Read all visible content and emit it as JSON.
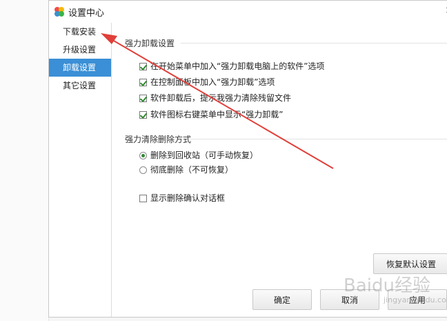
{
  "window": {
    "title": "设置中心",
    "close_glyph": "×"
  },
  "sidebar": {
    "items": [
      {
        "label": "下载安装",
        "active": false
      },
      {
        "label": "升级设置",
        "active": false
      },
      {
        "label": "卸载设置",
        "active": true
      },
      {
        "label": "其它设置",
        "active": false
      }
    ]
  },
  "uninstall_section": {
    "title": "强力卸载设置",
    "options": [
      {
        "label": "在开始菜单中加入“强力卸载电脑上的软件”选项",
        "checked": true
      },
      {
        "label": "在控制面板中加入“强力卸载”选项",
        "checked": true
      },
      {
        "label": "软件卸载后，提示我强力清除残留文件",
        "checked": true
      },
      {
        "label": "软件图标右键菜单中显示“强力卸载”",
        "checked": true
      }
    ]
  },
  "delete_section": {
    "title": "强力清除删除方式",
    "options": [
      {
        "label": "删除到回收站（可手动恢复）",
        "selected": true
      },
      {
        "label": "彻底删除（不可恢复）",
        "selected": false
      }
    ]
  },
  "confirm_dialog_option": {
    "label": "显示删除确认对话框",
    "checked": false
  },
  "buttons": {
    "restore_defaults": "恢复默认设置",
    "ok": "确定",
    "cancel": "取消",
    "apply": "应用"
  },
  "watermark": {
    "text": "Baidu经验",
    "sub": "jingyan.baidu.com"
  },
  "colors": {
    "accent": "#3a8fd6",
    "check": "#2e8b2e",
    "annotation_arrow": "#e0403a"
  },
  "icons": {
    "app_logo": "colorful-flower-logo-icon",
    "close": "close-icon"
  }
}
